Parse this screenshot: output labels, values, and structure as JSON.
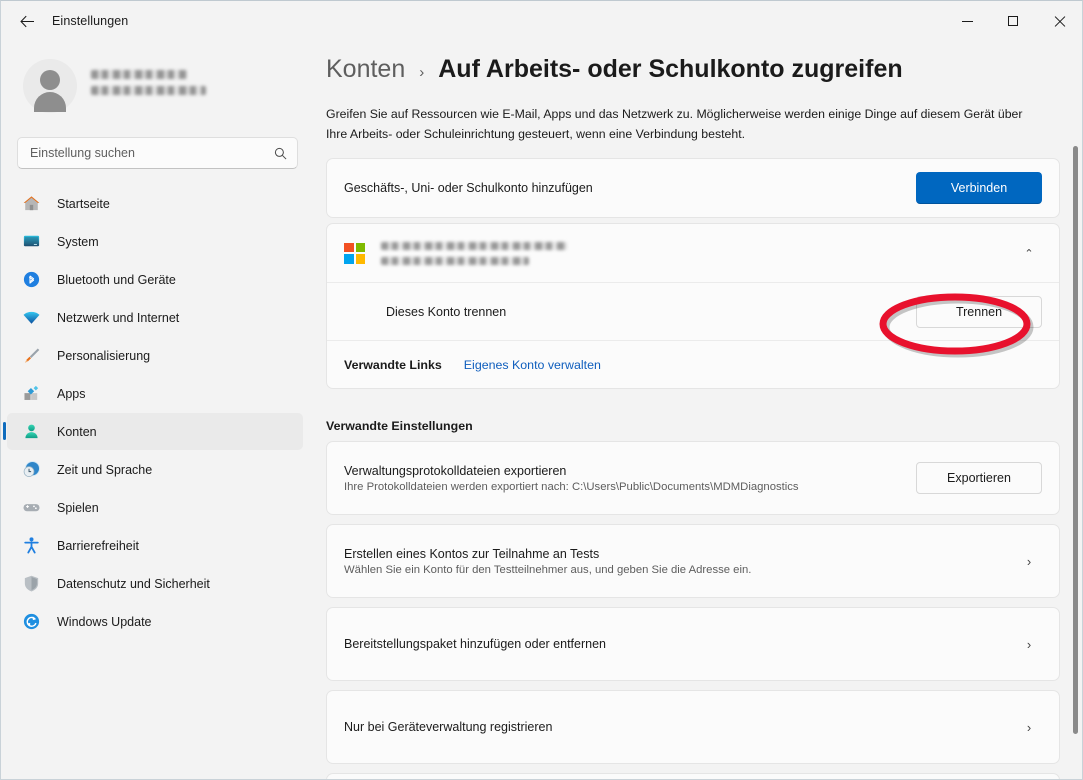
{
  "window": {
    "title": "Einstellungen",
    "back_icon": "back-arrow-icon",
    "minimize_label": "",
    "maximize_label": "",
    "close_label": ""
  },
  "sidebar": {
    "profile": {
      "name_redacted": "",
      "email_redacted": ""
    },
    "search": {
      "placeholder": "Einstellung suchen",
      "value": "",
      "icon": "search-icon"
    },
    "items": [
      {
        "label": "Startseite",
        "icon": "home-icon",
        "active": false
      },
      {
        "label": "System",
        "icon": "monitor-icon",
        "active": false
      },
      {
        "label": "Bluetooth und Geräte",
        "icon": "bluetooth-icon",
        "active": false
      },
      {
        "label": "Netzwerk und Internet",
        "icon": "wifi-icon",
        "active": false
      },
      {
        "label": "Personalisierung",
        "icon": "paintbrush-icon",
        "active": false
      },
      {
        "label": "Apps",
        "icon": "apps-icon",
        "active": false
      },
      {
        "label": "Konten",
        "icon": "person-icon",
        "active": true
      },
      {
        "label": "Zeit und Sprache",
        "icon": "clock-globe-icon",
        "active": false
      },
      {
        "label": "Spielen",
        "icon": "gamepad-icon",
        "active": false
      },
      {
        "label": "Barrierefreiheit",
        "icon": "accessibility-icon",
        "active": false
      },
      {
        "label": "Datenschutz und Sicherheit",
        "icon": "shield-icon",
        "active": false
      },
      {
        "label": "Windows Update",
        "icon": "update-icon",
        "active": false
      }
    ]
  },
  "breadcrumb": {
    "parent": "Konten",
    "separator": "›",
    "current": "Auf Arbeits- oder Schulkonto zugreifen"
  },
  "intro": "Greifen Sie auf Ressourcen wie E-Mail, Apps und das Netzwerk zu. Möglicherweise werden einige Dinge auf diesem Gerät über Ihre Arbeits- oder Schuleinrichtung gesteuert, wenn eine Verbindung besteht.",
  "add_account": {
    "title": "Geschäfts-, Uni- oder Schulkonto hinzufügen",
    "button": "Verbinden"
  },
  "account": {
    "logo": "microsoft-logo-icon",
    "name_redacted": "",
    "detail_redacted": "",
    "collapse_icon": "chevron-up-icon",
    "disconnect_title": "Dieses Konto trennen",
    "disconnect_button": "Trennen",
    "related_links_label": "Verwandte Links",
    "related_link": "Eigenes Konto verwalten"
  },
  "related_settings": {
    "heading": "Verwandte Einstellungen",
    "items": [
      {
        "title": "Verwaltungsprotokolldateien exportieren",
        "subtitle": "Ihre Protokolldateien werden exportiert nach: C:\\Users\\Public\\Documents\\MDMDiagnostics",
        "action_type": "button",
        "button": "Exportieren"
      },
      {
        "title": "Erstellen eines Kontos zur Teilnahme an Tests",
        "subtitle": "Wählen Sie ein Konto für den Testteilnehmer aus, und geben Sie die Adresse ein.",
        "action_type": "chevron",
        "button": "›"
      },
      {
        "title": "Bereitstellungspaket hinzufügen oder entfernen",
        "subtitle": "",
        "action_type": "chevron",
        "button": "›"
      },
      {
        "title": "Nur bei Geräteverwaltung registrieren",
        "subtitle": "",
        "action_type": "chevron",
        "button": "›"
      }
    ]
  },
  "annotation": {
    "shape": "red-ellipse-highlight",
    "color": "#e8112d",
    "targets": "Trennen"
  },
  "colors": {
    "accent": "#0067c0",
    "link": "#0f5ebd",
    "annotation_red": "#e8112d",
    "window_bg": "#f3f3f3",
    "card_bg": "#fbfbfb"
  }
}
